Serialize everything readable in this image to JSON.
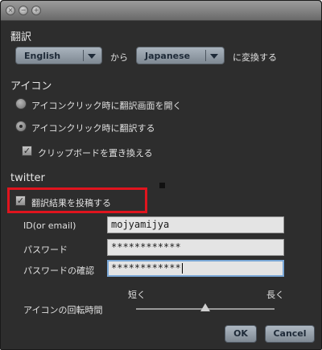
{
  "window": {
    "buttons": [
      "×",
      "−",
      "+"
    ]
  },
  "translation": {
    "section_title": "翻訳",
    "source_lang": "English",
    "from_label": "から",
    "target_lang": "Japanese",
    "convert_label": "に変換する"
  },
  "icon": {
    "section_title": "アイコン",
    "option_open_window": "アイコンクリック時に翻訳画面を開く",
    "option_translate": "アイコンクリック時に翻訳する",
    "selected_option": "option_translate",
    "replace_clipboard_label": "クリップボードを置き換える",
    "replace_clipboard_checked": true
  },
  "twitter": {
    "section_title": "twitter",
    "post_result_label": "翻訳結果を投稿する",
    "post_result_checked": true,
    "id_label": "ID(or email)",
    "id_value": "mojyamijya",
    "password_label": "パスワード",
    "password_value": "************",
    "password_confirm_label": "パスワードの確認",
    "password_confirm_value": "************"
  },
  "rotation": {
    "label": "アイコンの回転時間",
    "short_label": "短く",
    "long_label": "長く",
    "value_fraction": 0.5
  },
  "actions": {
    "ok": "OK",
    "cancel": "Cancel"
  },
  "colors": {
    "highlight": "#e0141e",
    "accent_button": "#aeb8c2"
  }
}
